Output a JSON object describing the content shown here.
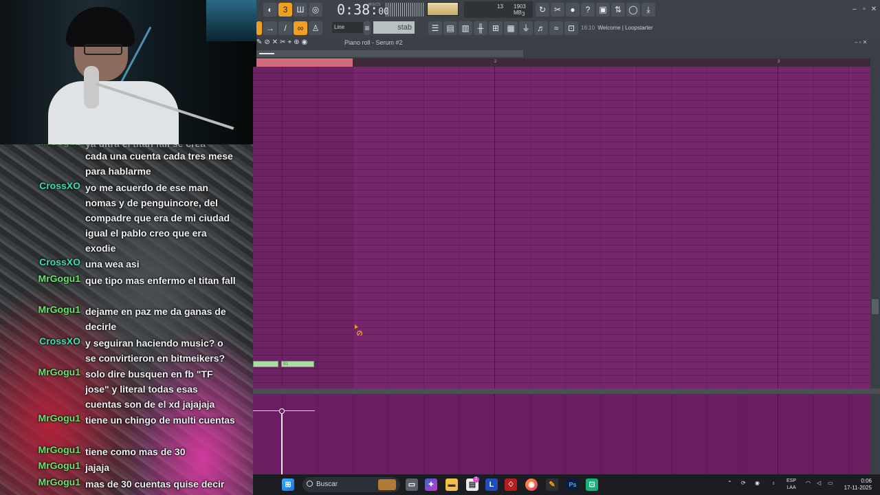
{
  "chat": {
    "top_partial": "ya ultra el titan fall se crea",
    "messages": [
      {
        "user": "",
        "text": "cada una cuenta cada tres mese para hablarme",
        "color": "green"
      },
      {
        "user": "CrossXO",
        "text": "yo me acuerdo de ese man nomas y de penguincore, del compadre que era de mi ciudad igual el pablo creo que era exodie",
        "color": "teal"
      },
      {
        "user": "CrossXO",
        "text": "una wea asi",
        "color": "teal"
      },
      {
        "user": "MrGogu1",
        "text": "que tipo mas enfermo el titan fall",
        "color": "green"
      },
      {
        "user": "MrGogu1",
        "text": "dejame en paz me da ganas de decirle",
        "color": "green"
      },
      {
        "user": "CrossXO",
        "text": "y seguiran haciendo music? o se convirtieron en bitmeikers?",
        "color": "teal"
      },
      {
        "user": "MrGogu1",
        "text": "solo dire busquen en fb \"TF jose\" y literal todas esas cuentas son de el xd jajajaja",
        "color": "green"
      },
      {
        "user": "MrGogu1",
        "text": "tiene un chingo de multi cuentas",
        "color": "green"
      },
      {
        "user": "MrGogu1",
        "text": "tiene como mas de 30",
        "color": "green"
      },
      {
        "user": "MrGogu1",
        "text": "jajaja",
        "color": "green"
      },
      {
        "user": "MrGogu1",
        "text": "mas de 30 cuentas quise decir",
        "color": "green"
      }
    ]
  },
  "toolbar": {
    "time": "0:38:",
    "time_small": "00",
    "time_label": "M:S:CS",
    "cpu_value": "13",
    "ram_value": "1903 MB",
    "poly_value": "3",
    "snap": "Line",
    "pattern": "stab",
    "hint_prefix": "16:10",
    "hint_text": "Welcome | Loopstarter"
  },
  "piano_roll": {
    "title": "Piano roll - Serum #2",
    "bar_numbers": [
      "2",
      "3"
    ],
    "note_label": "B1",
    "colors": {
      "grid": "#6f1d66",
      "note": "#a9e0a0",
      "loop": "#d46a7a"
    }
  },
  "taskbar": {
    "search_placeholder": "Buscar",
    "lang_top": "ESP",
    "lang_bottom": "LAA",
    "time": "0:06",
    "date": "17-11-2025",
    "badge": "1"
  }
}
